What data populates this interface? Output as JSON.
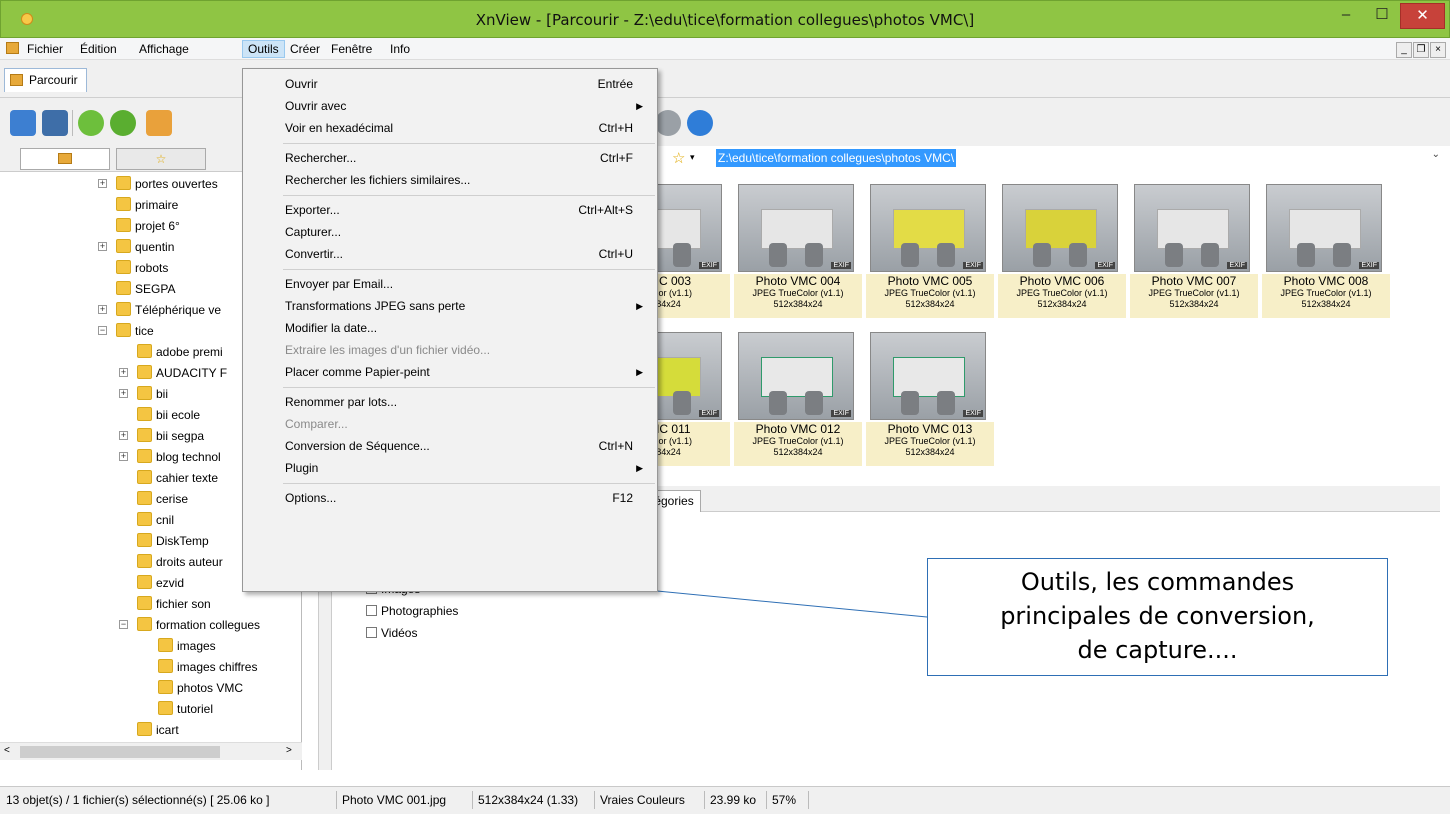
{
  "window": {
    "title": "XnView - [Parcourir - Z:\\edu\\tice\\formation collegues\\photos VMC\\]",
    "min_glyph": "–",
    "max_glyph": "☐",
    "close_glyph": "✕"
  },
  "menubar": {
    "items": [
      "Fichier",
      "Édition",
      "Affichage",
      "Outils",
      "Créer",
      "Fenêtre",
      "Info"
    ],
    "active": "Outils"
  },
  "tabs": {
    "browse_label": "Parcourir"
  },
  "address": {
    "path": "Z:\\edu\\tice\\formation collegues\\photos VMC\\"
  },
  "tree": {
    "items": [
      {
        "label": "portes ouvertes",
        "expandable": true
      },
      {
        "label": "primaire",
        "expandable": false
      },
      {
        "label": "projet 6°",
        "expandable": false
      },
      {
        "label": "quentin",
        "expandable": true
      },
      {
        "label": "robots",
        "expandable": false
      },
      {
        "label": "SEGPA",
        "expandable": false
      },
      {
        "label": "Téléphérique ve",
        "expandable": true
      },
      {
        "label": "tice",
        "expandable": true,
        "expanded": true
      },
      {
        "label": "adobe premi",
        "expandable": false
      },
      {
        "label": "AUDACITY F",
        "expandable": true
      },
      {
        "label": "bii",
        "expandable": true
      },
      {
        "label": "bii ecole",
        "expandable": false
      },
      {
        "label": "bii segpa",
        "expandable": true
      },
      {
        "label": "blog technol",
        "expandable": true
      },
      {
        "label": "cahier texte",
        "expandable": false
      },
      {
        "label": "cerise",
        "expandable": false
      },
      {
        "label": "cnil",
        "expandable": false
      },
      {
        "label": "DiskTemp",
        "expandable": false
      },
      {
        "label": "droits auteur",
        "expandable": false
      },
      {
        "label": "ezvid",
        "expandable": false
      },
      {
        "label": "fichier son",
        "expandable": false
      },
      {
        "label": "formation collegues",
        "expandable": true,
        "expanded": true
      },
      {
        "label": "images",
        "expandable": false
      },
      {
        "label": "images chiffres",
        "expandable": false
      },
      {
        "label": "photos VMC",
        "expandable": false
      },
      {
        "label": "tutoriel",
        "expandable": false
      },
      {
        "label": "icart",
        "expandable": false
      }
    ]
  },
  "thumbnails": [
    {
      "name": "VMC 003",
      "type": "eColor (v1.1)",
      "size": "384x24"
    },
    {
      "name": "Photo  VMC 004",
      "type": "JPEG TrueColor (v1.1)",
      "size": "512x384x24"
    },
    {
      "name": "Photo  VMC 005",
      "type": "JPEG TrueColor (v1.1)",
      "size": "512x384x24"
    },
    {
      "name": "Photo  VMC 006",
      "type": "JPEG TrueColor (v1.1)",
      "size": "512x384x24"
    },
    {
      "name": "Photo  VMC 007",
      "type": "JPEG TrueColor (v1.1)",
      "size": "512x384x24"
    },
    {
      "name": "Photo  VMC 008",
      "type": "JPEG TrueColor (v1.1)",
      "size": "512x384x24"
    },
    {
      "name": "VMC 011",
      "type": "eColor (v1.1)",
      "size": "384x24"
    },
    {
      "name": "Photo  VMC 012",
      "type": "JPEG TrueColor (v1.1)",
      "size": "512x384x24"
    },
    {
      "name": "Photo  VMC 013",
      "type": "JPEG TrueColor (v1.1)",
      "size": "512x384x24"
    }
  ],
  "exif_badge": "EXIF",
  "categories": {
    "tab_label": "tégories",
    "items": [
      "Images",
      "Photographies",
      "Vidéos"
    ]
  },
  "dropdown": {
    "items": [
      {
        "label": "Ouvrir",
        "shortcut": "Entrée"
      },
      {
        "label": "Ouvrir avec",
        "submenu": true
      },
      {
        "label": "Voir en hexadécimal",
        "shortcut": "Ctrl+H"
      },
      {
        "label": "Rechercher...",
        "shortcut": "Ctrl+F"
      },
      {
        "label": "Rechercher les fichiers similaires..."
      },
      {
        "label": "Exporter...",
        "shortcut": "Ctrl+Alt+S"
      },
      {
        "label": "Capturer..."
      },
      {
        "label": "Convertir...",
        "shortcut": "Ctrl+U"
      },
      {
        "label": "Envoyer par Email..."
      },
      {
        "label": "Transformations JPEG sans perte",
        "submenu": true
      },
      {
        "label": "Modifier la date..."
      },
      {
        "label": "Extraire les images d'un fichier vidéo...",
        "disabled": true
      },
      {
        "label": "Placer comme Papier-peint",
        "submenu": true
      },
      {
        "label": "Renommer par lots..."
      },
      {
        "label": "Comparer...",
        "disabled": true
      },
      {
        "label": "Conversion de Séquence...",
        "shortcut": "Ctrl+N"
      },
      {
        "label": "Plugin",
        "submenu": true
      },
      {
        "label": "Options...",
        "shortcut": "F12"
      }
    ]
  },
  "callout": {
    "line1": "Outils, les commandes",
    "line2": "principales de conversion,",
    "line3": "de capture...."
  },
  "statusbar": {
    "selection": "13 objet(s) / 1 fichier(s) sélectionné(s)  [ 25.06 ko ]",
    "filename": "Photo  VMC 001.jpg",
    "dims": "512x384x24 (1.33)",
    "colors": "Vraies Couleurs",
    "filesize": "23.99 ko",
    "zoom": "57%"
  },
  "colors": {
    "titlebar": "#8fc544",
    "close": "#c7423a",
    "selection": "#3399ff",
    "caption_bg": "#f7efc8"
  }
}
